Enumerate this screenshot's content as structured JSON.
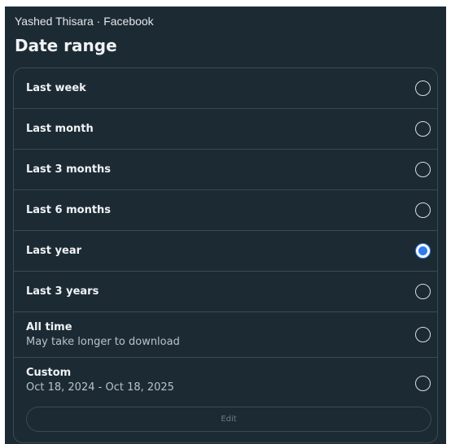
{
  "header": {
    "account": "Yashed Thisara · Facebook",
    "title": "Date range"
  },
  "options": [
    {
      "label": "Last week",
      "selected": false
    },
    {
      "label": "Last month",
      "selected": false
    },
    {
      "label": "Last 3 months",
      "selected": false
    },
    {
      "label": "Last 6 months",
      "selected": false
    },
    {
      "label": "Last year",
      "selected": true
    },
    {
      "label": "Last 3 years",
      "selected": false
    },
    {
      "label": "All time",
      "sub": "May take longer to download",
      "selected": false
    },
    {
      "label": "Custom",
      "sub": "Oct 18, 2024 - Oct 18, 2025",
      "selected": false
    }
  ],
  "edit_label": "Edit",
  "colors": {
    "background": "#1c2b33",
    "accent": "#2f7bf0",
    "divider": "#3a4a53"
  }
}
